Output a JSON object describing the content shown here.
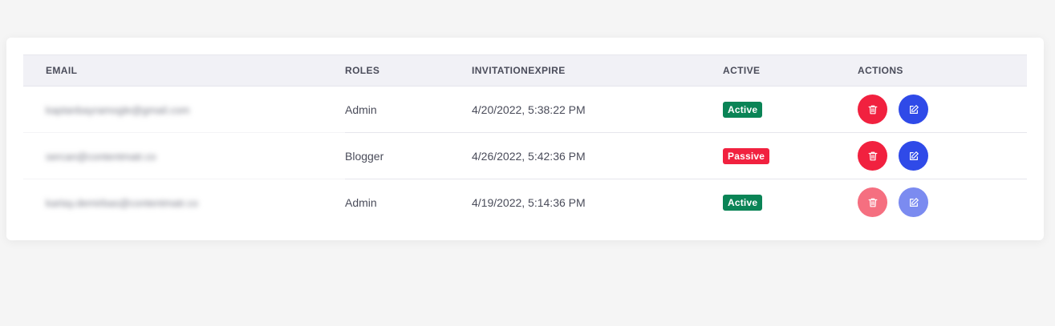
{
  "table": {
    "headers": [
      "EMAIL",
      "ROLES",
      "INVITATIONEXPIRE",
      "ACTIVE",
      "ACTIONS"
    ],
    "rows": [
      {
        "email": "kaptanbayramogle@gmail.com",
        "role": "Admin",
        "invitation_expire": "4/20/2022, 5:38:22 PM",
        "status": "Active",
        "status_color": "#0a8456"
      },
      {
        "email": "sercan@contentmatr.co",
        "role": "Blogger",
        "invitation_expire": "4/26/2022, 5:42:36 PM",
        "status": "Passive",
        "status_color": "#f1213f"
      },
      {
        "email": "kartay.demirbas@contentmatr.co",
        "role": "Admin",
        "invitation_expire": "4/19/2022, 5:14:36 PM",
        "status": "Active",
        "status_color": "#0a8456"
      }
    ]
  },
  "icons": {
    "delete": "trash-icon",
    "edit": "edit-icon"
  },
  "colors": {
    "delete_button": "#f1213f",
    "edit_button": "#2f4ae8",
    "active_badge": "#0a8456",
    "passive_badge": "#f1213f"
  }
}
